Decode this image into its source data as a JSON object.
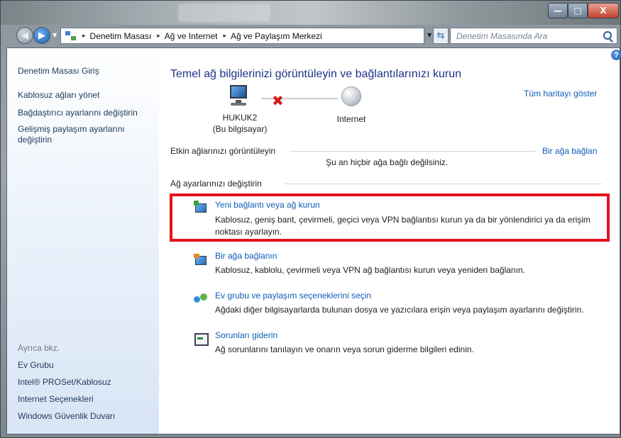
{
  "window": {
    "controls": {
      "minimize": "—",
      "maximize": "□",
      "close": "X"
    }
  },
  "address_bar": {
    "breadcrumbs": [
      "Denetim Masası",
      "Ağ ve Internet",
      "Ağ ve Paylaşım Merkezi"
    ],
    "separator": "▸",
    "search_placeholder": "Denetim Masasında Ara"
  },
  "sidebar": {
    "items": [
      "Denetim Masası Giriş",
      "Kablosuz ağları yönet",
      "Bağdaştırıcı ayarlarını değiştirin",
      "Gelişmiş paylaşım ayarlarını değiştirin"
    ],
    "see_also_label": "Ayrıca bkz.",
    "see_also": [
      "Ev Grubu",
      "Intel® PROSet/Kablosuz",
      "Internet Seçenekleri",
      "Windows Güvenlik Duvarı"
    ]
  },
  "main": {
    "help": "?",
    "heading": "Temel ağ bilgilerinizi görüntüleyin ve bağlantılarınızı kurun",
    "full_map_link": "Tüm haritayı göster",
    "computer_name": "HUKUK2",
    "computer_sub": "(Bu bilgisayar)",
    "internet_label": "Internet",
    "disconnected_mark": "✖",
    "active_networks_label": "Etkin ağlarınızı görüntüleyin",
    "connect_link": "Bir ağa bağlan",
    "no_network_text": "Şu an hiçbir ağa bağlı değilsiniz.",
    "change_settings_label": "Ağ ayarlarınızı değiştirin",
    "tasks": [
      {
        "icon": "new-connection-icon",
        "title": "Yeni bağlantı veya ağ kurun",
        "desc": [
          "Kablosuz, geniş bant, çevirmeli, geçici veya VPN bağlantısı kurun ya da bir yönlendirici ya da erişim",
          "noktası ayarlayın."
        ]
      },
      {
        "icon": "connect-network-icon",
        "title": "Bir ağa bağlanın",
        "desc": [
          "Kablosuz, kablolu, çevirmeli veya VPN ağ bağlantısı kurun veya yeniden bağlanın."
        ]
      },
      {
        "icon": "homegroup-icon",
        "title": "Ev grubu ve paylaşım seçeneklerini seçin",
        "desc": [
          "Ağdaki diğer bilgisayarlarda bulunan dosya ve yazıcılara erişin veya paylaşım ayarlarını değiştirin."
        ]
      },
      {
        "icon": "troubleshoot-icon",
        "title": "Sorunları giderin",
        "desc": [
          "Ağ sorunlarını tanılayın ve onarın veya sorun giderme bilgileri edinin."
        ]
      }
    ],
    "highlight_color": "#e4121c"
  }
}
